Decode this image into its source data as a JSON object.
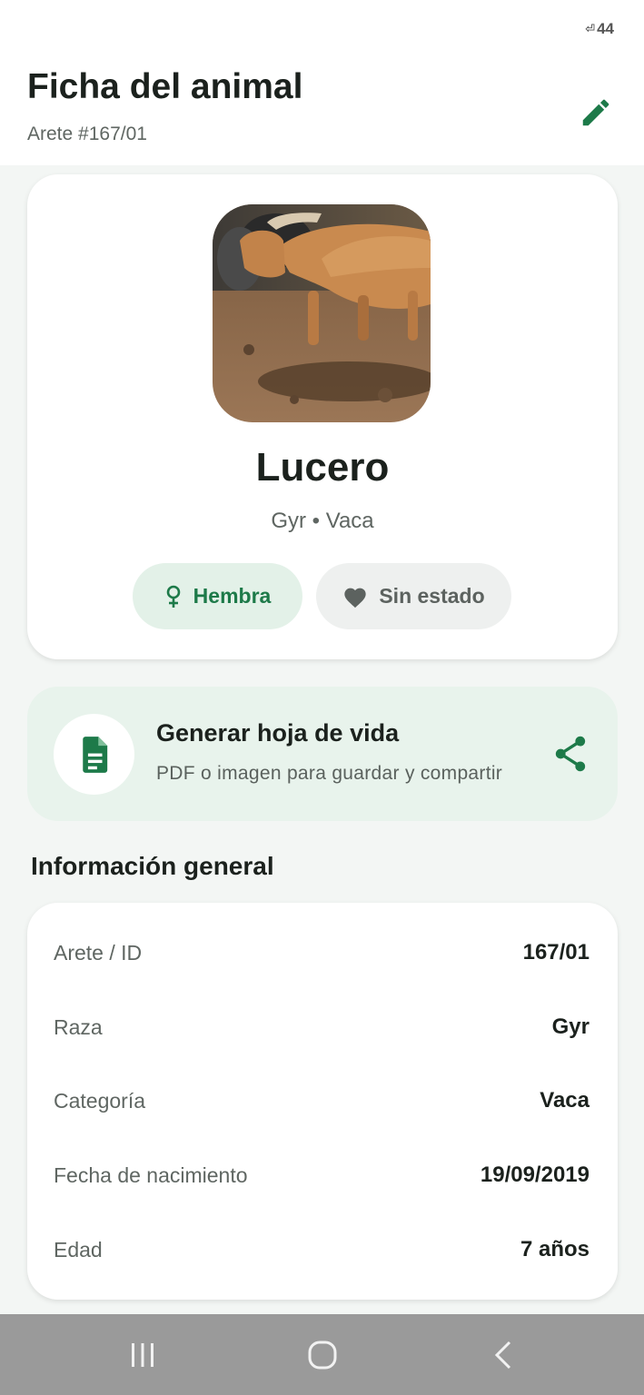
{
  "status_bar": {
    "battery": "44"
  },
  "header": {
    "title": "Ficha del animal",
    "subtitle": "Arete #167/01"
  },
  "profile": {
    "name": "Lucero",
    "breed_category": "Gyr • Vaca",
    "chips": {
      "sex": "Hembra",
      "state": "Sin estado"
    }
  },
  "document_card": {
    "title": "Generar hoja de vida",
    "subtitle": "PDF o imagen para guardar y compartir"
  },
  "general_info": {
    "title": "Información general",
    "rows": [
      {
        "label": "Arete / ID",
        "value": "167/01"
      },
      {
        "label": "Raza",
        "value": "Gyr"
      },
      {
        "label": "Categoría",
        "value": "Vaca"
      },
      {
        "label": "Fecha de nacimiento",
        "value": "19/09/2019"
      },
      {
        "label": "Edad",
        "value": "7 años"
      }
    ]
  },
  "colors": {
    "accent_green": "#1d7a49",
    "chip_green_bg": "#e3f1e8",
    "doc_card_bg": "#e8f3ec",
    "background": "#f3f6f4"
  },
  "icons": {
    "edit": "pencil-icon",
    "sex": "female-symbol-icon",
    "state": "heart-icon",
    "document": "document-icon",
    "share": "share-icon",
    "nav_recent": "recent-apps-icon",
    "nav_home": "home-icon",
    "nav_back": "back-icon"
  }
}
